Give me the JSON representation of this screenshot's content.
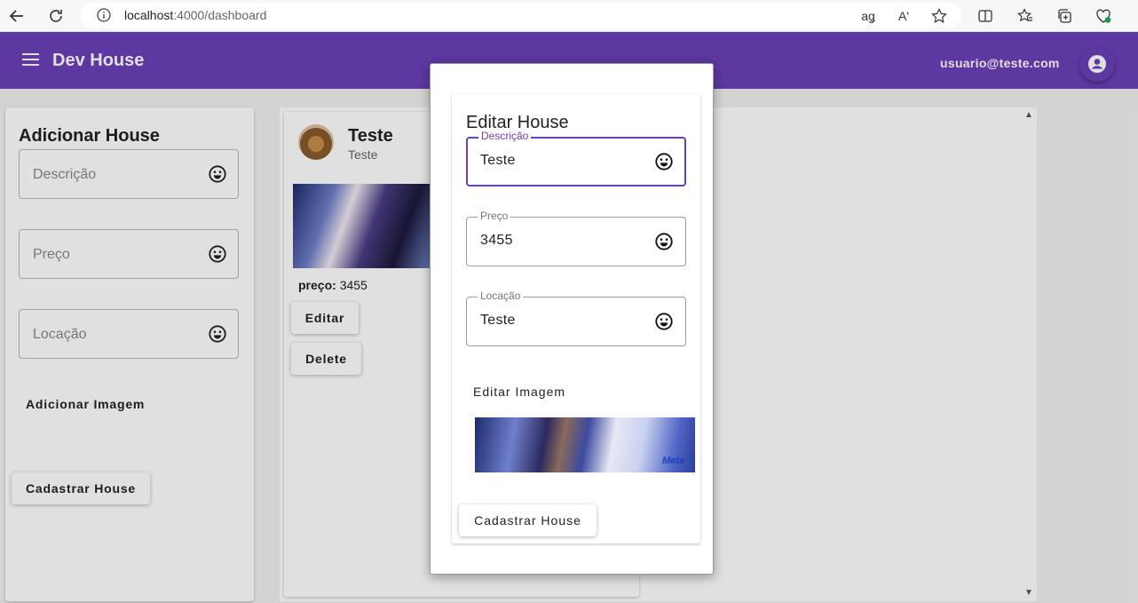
{
  "browser": {
    "url_host": "localhost",
    "url_path": ":4000/dashboard",
    "read_aloud_icon": "Aʹ",
    "translate_icon": "aǥ"
  },
  "appbar": {
    "title": "Dev House",
    "user_email": "usuario@teste.com",
    "color": "#6a40b8"
  },
  "add_form": {
    "title": "Adicionar House",
    "fields": [
      {
        "placeholder": "Descrição"
      },
      {
        "placeholder": "Preço"
      },
      {
        "placeholder": "Locação"
      }
    ],
    "add_image_label": "Adicionar Imagem",
    "submit_label": "Cadastrar House"
  },
  "house_list": {
    "items": [
      {
        "owner_name": "Teste",
        "owner_sub": "Teste",
        "price_label": "preço:",
        "price_value": "3455",
        "edit_label": "Editar",
        "delete_label": "Delete"
      }
    ]
  },
  "edit_dialog": {
    "title": "Editar House",
    "fields": [
      {
        "label": "Descrição",
        "value": "Teste"
      },
      {
        "label": "Preço",
        "value": "3455"
      },
      {
        "label": "Locação",
        "value": "Teste"
      }
    ],
    "edit_image_label": "Editar Imagem",
    "image_logo_text": "Meta",
    "submit_label": "Cadastrar House"
  }
}
